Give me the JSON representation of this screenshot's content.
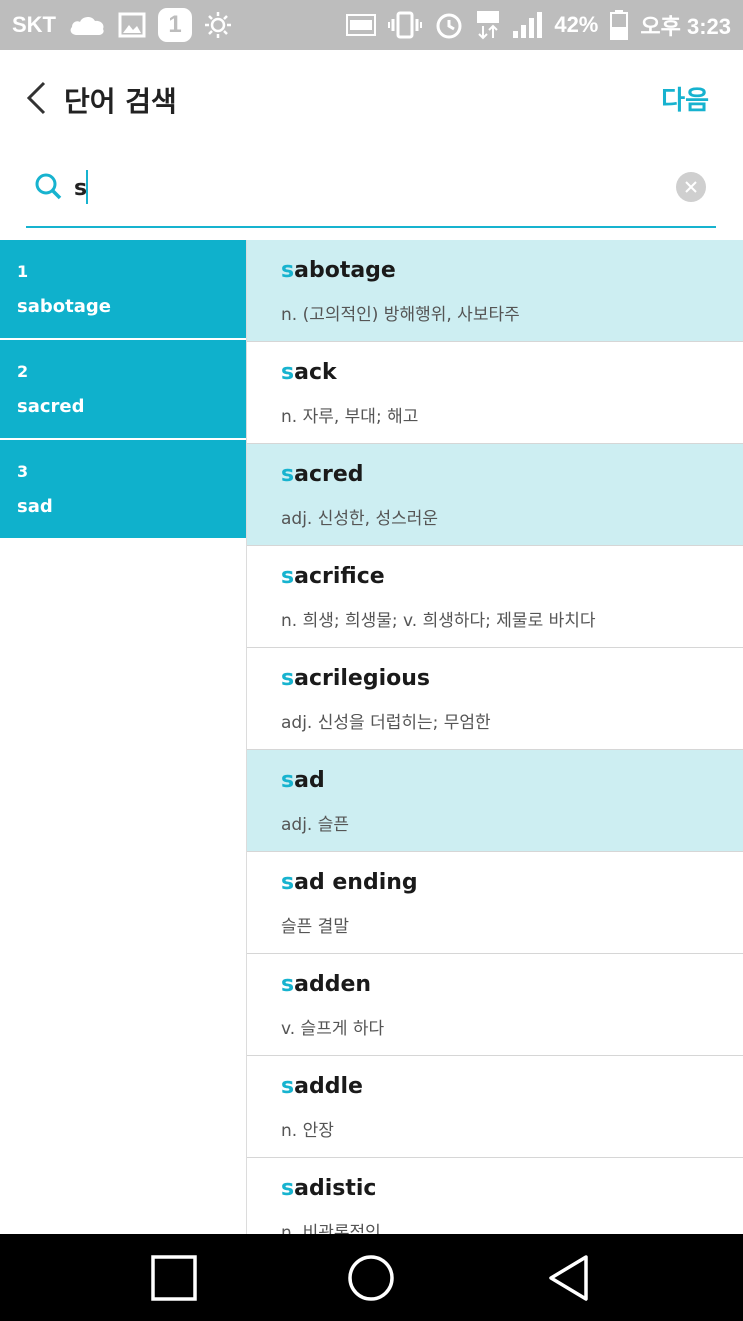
{
  "status_bar": {
    "carrier": "SKT",
    "notification_count": "1",
    "battery_percent": "42%",
    "time": "오후 3:23"
  },
  "app_bar": {
    "title": "단어 검색",
    "next_label": "다음"
  },
  "search": {
    "value": "s",
    "placeholder": ""
  },
  "selected_words": [
    {
      "index": "1",
      "word": "sabotage"
    },
    {
      "index": "2",
      "word": "sacred"
    },
    {
      "index": "3",
      "word": "sad"
    }
  ],
  "results": [
    {
      "match": "s",
      "rest": "abotage",
      "definition": "n. (고의적인) 방해행위, 사보타주",
      "selected": true
    },
    {
      "match": "s",
      "rest": "ack",
      "definition": "n. 자루, 부대; 해고",
      "selected": false
    },
    {
      "match": "s",
      "rest": "acred",
      "definition": "adj. 신성한, 성스러운",
      "selected": true
    },
    {
      "match": "s",
      "rest": "acrifice",
      "definition": "n. 희생; 희생물; v. 희생하다; 제물로 바치다",
      "selected": false
    },
    {
      "match": "s",
      "rest": "acrilegious",
      "definition": "adj. 신성을 더럽히는; 무엄한",
      "selected": false
    },
    {
      "match": "s",
      "rest": "ad",
      "definition": "adj. 슬픈",
      "selected": true
    },
    {
      "match": "s",
      "rest": "ad ending",
      "definition": "슬픈 결말",
      "selected": false
    },
    {
      "match": "s",
      "rest": "adden",
      "definition": "v. 슬프게 하다",
      "selected": false
    },
    {
      "match": "s",
      "rest": "addle",
      "definition": "n. 안장",
      "selected": false
    },
    {
      "match": "s",
      "rest": "adistic",
      "definition": "n. 비관론적인",
      "selected": false
    }
  ],
  "colors": {
    "accent": "#17b3cf",
    "selected_row": "#cdeef2",
    "left_pane": "#0fb1cc",
    "status_bar": "#bdbdbd",
    "nav_bar": "#000000"
  },
  "icons": {
    "status_left": [
      "cloud-icon",
      "image-icon",
      "notification-count-icon",
      "brightness-icon"
    ],
    "status_right": [
      "nfc-icon",
      "vibrate-icon",
      "alarm-icon",
      "lte-icon",
      "signal-icon",
      "battery-icon"
    ],
    "app_bar": [
      "back-chevron-icon"
    ],
    "search": [
      "search-icon",
      "clear-icon"
    ],
    "nav": [
      "recent-apps-icon",
      "home-icon",
      "back-icon"
    ]
  }
}
